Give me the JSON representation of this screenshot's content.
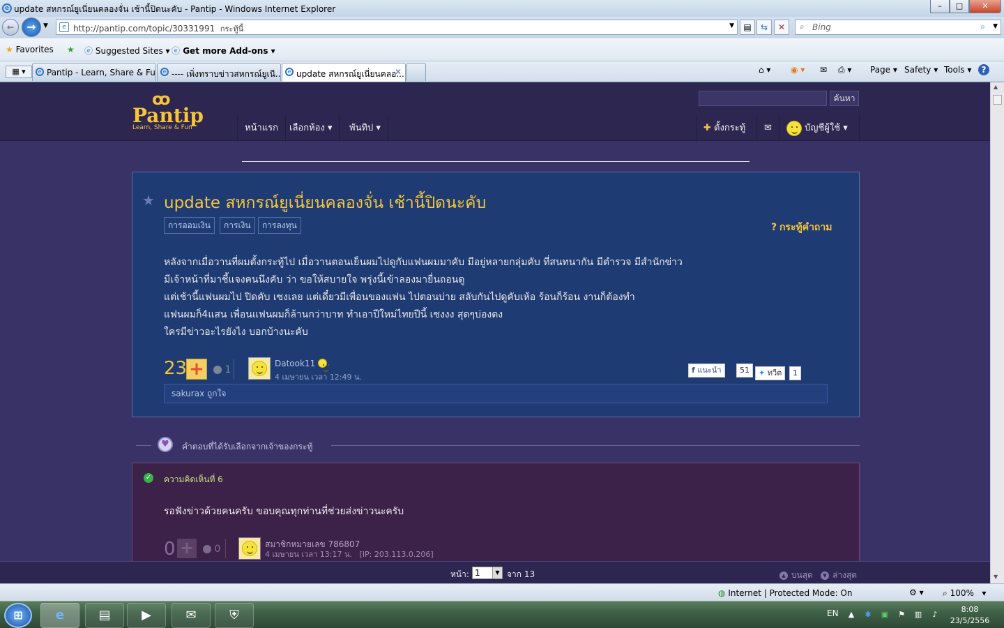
{
  "window": {
    "title": "update สหกรณ์ยูเนี่ยนคลองจั่น เช้านี้ปิดนะคับ - Pantip - Windows Internet Explorer",
    "min": "–",
    "max": "□",
    "close": "✕"
  },
  "address": {
    "url": "http://pantip.com/topic/30331991",
    "url_hint": "กระทู้นี้",
    "search_placeholder": "Bing"
  },
  "favorites": {
    "favorites_label": "Favorites",
    "suggested": "Suggested Sites ▾",
    "addons": "Get more Add-ons ▾"
  },
  "tabs": [
    {
      "label": "Pantip - Learn, Share & Fun"
    },
    {
      "label": "---- เพิ่งทราบข่าวสหกรณ์ยูเนี..."
    },
    {
      "label": "update สหกรณ์ยูเนี่ยนคลอ..."
    }
  ],
  "commandbar": {
    "page": "Page ▾",
    "safety": "Safety ▾",
    "tools": "Tools ▾",
    "help": "?"
  },
  "site": {
    "logo_word": "Pantip",
    "logo_tag": "Learn, Share & Fun",
    "search_button": "ค้นหา",
    "nav": {
      "home": "หน้าแรก",
      "rooms": "เลือกห้อง ▾",
      "pantip": "พันทิป ▾",
      "new_topic": "ตั้งกระทู้",
      "account": "บัญชีผู้ใช้ ▾"
    }
  },
  "topic": {
    "title": "update สหกรณ์ยูเนี่ยนคลองจั่น เช้านี้ปิดนะคับ",
    "tags": [
      "การออมเงิน",
      "การเงิน",
      "การลงทุน"
    ],
    "type": "กระทู้คำถาม",
    "body": [
      "หลังจากเมื่อวานที่ผมตั้งกระทู้ไป เมื่อวานตอนเย็นผมไปดูกับแฟนผมมาคับ มีอยู่หลายกลุ่มคับ ที่สนทนากัน มีตำรวจ มีสำนักข่าว",
      "มีเจ้าหน้าที่มาชี้แจงคนนึงคับ ว่า ขอให้สบายใจ พรุ่งนี้เข้าลองมายื่นถอนดู",
      "แต่เช้านี้แฟนผมไป ปิดคับ เซงเลย แต่เดี๋ยวมีเพื่อนของแฟน ไปตอนบ่าย สลับกันไปดูคับเห้อ ร้อนก็ร้อน งานก็ต้องทำ",
      "แฟนผมก็4แสน เพื่อนแฟนผมก็ล้านกว่าบาท ทำเอาปีใหม่ไทยปีนี้ เซงงง สุดๆบ่องดง",
      "ใครมีข่าวอะไรยังไง บอกบ้างนะคับ"
    ],
    "votes": "23",
    "emotions": "1",
    "author": "Datook11",
    "time": "4 เมษายน เวลา 12:49 น.",
    "fb_label": "แนะนำ",
    "fb_count": "51",
    "tw_label": "ทวีต",
    "tw_count": "1",
    "likes": "sakurax ถูกใจ"
  },
  "best_answer": {
    "heading": "คำตอบที่ได้รับเลือกจากเจ้าของกระทู้"
  },
  "comment": {
    "number": "ความคิดเห็นที่ 6",
    "text": "รอฟังข่าวด้วยคนครับ ขอบคุณทุกท่านที่ช่วยส่งข่าวนะครับ",
    "votes": "0",
    "emotions": "0",
    "author": "สมาชิกหมายเลข 786807",
    "time": "4 เมษายน เวลา 13:17 น.",
    "ip": "[IP: 203.113.0.206]"
  },
  "pager": {
    "label": "หน้า:",
    "current": "1",
    "total": "จาก 13",
    "top": "บนสุด",
    "bottom": "ล่างสุด"
  },
  "status": {
    "zone": "Internet | Protected Mode: On",
    "zoom": "100%"
  },
  "taskbar": {
    "lang": "EN",
    "time": "8:08",
    "date": "23/5/2556"
  },
  "colors": {
    "page_bg": "#393266",
    "topic_bg": "#1f3b73",
    "comment_bg": "#3c2148",
    "accent": "#f5c63c"
  }
}
